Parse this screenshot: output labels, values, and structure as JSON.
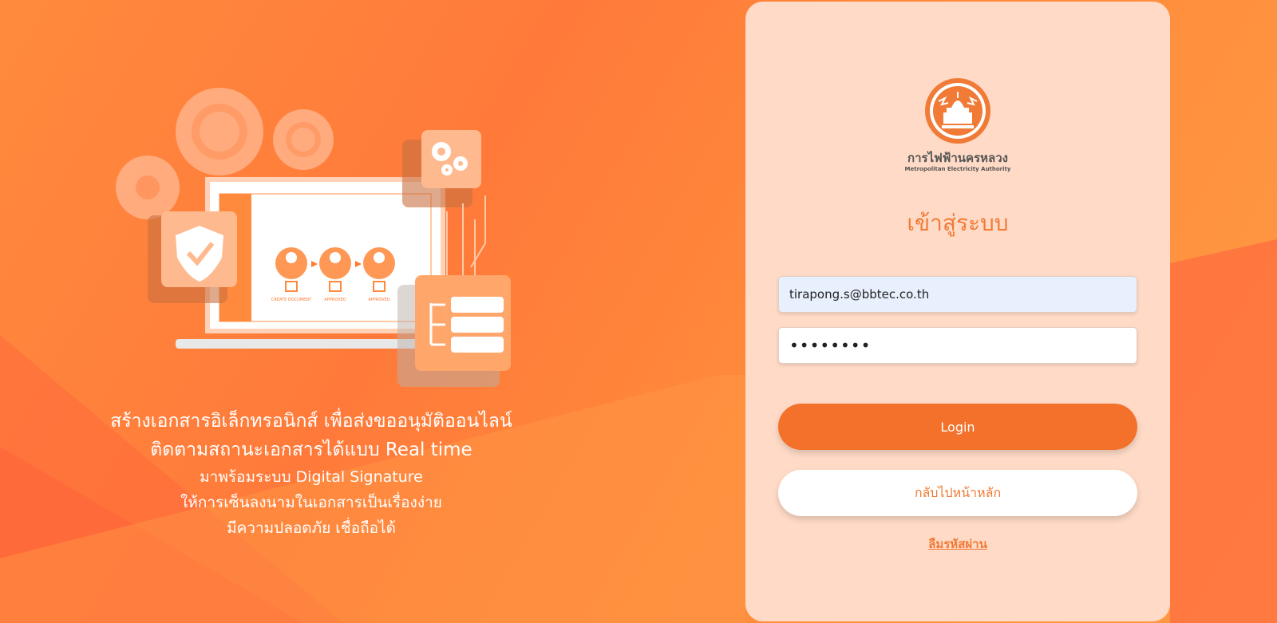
{
  "hero": {
    "line1": "สร้างเอกสารอิเล็กทรอนิกส์ เพื่อส่งขออนุมัติออนไลน์",
    "line2": "ติดตามสถานะเอกสารได้แบบ Real time",
    "line3": "มาพร้อมระบบ Digital Signature",
    "line4": "ให้การเซ็นลงนามในเอกสารเป็นเรื่องง่าย",
    "line5": "มีความปลอดภัย เชื่อถือได้",
    "steps": [
      "CREATE DOCUMENT",
      "APPROVED",
      "APPROVED"
    ]
  },
  "logo": {
    "name_th": "การไฟฟ้านครหลวง",
    "name_en": "Metropolitan Electricity Authority"
  },
  "login": {
    "title": "เข้าสู่ระบบ",
    "email_value": "tirapong.s@bbtec.co.th",
    "password_value": "••••••••",
    "login_label": "Login",
    "home_label": "กลับไปหน้าหลัก",
    "forgot_label": "ลืมรหัสผ่าน"
  },
  "colors": {
    "accent": "#f3712a",
    "card": "#ffdac6",
    "bg": "#ff8a3d"
  }
}
